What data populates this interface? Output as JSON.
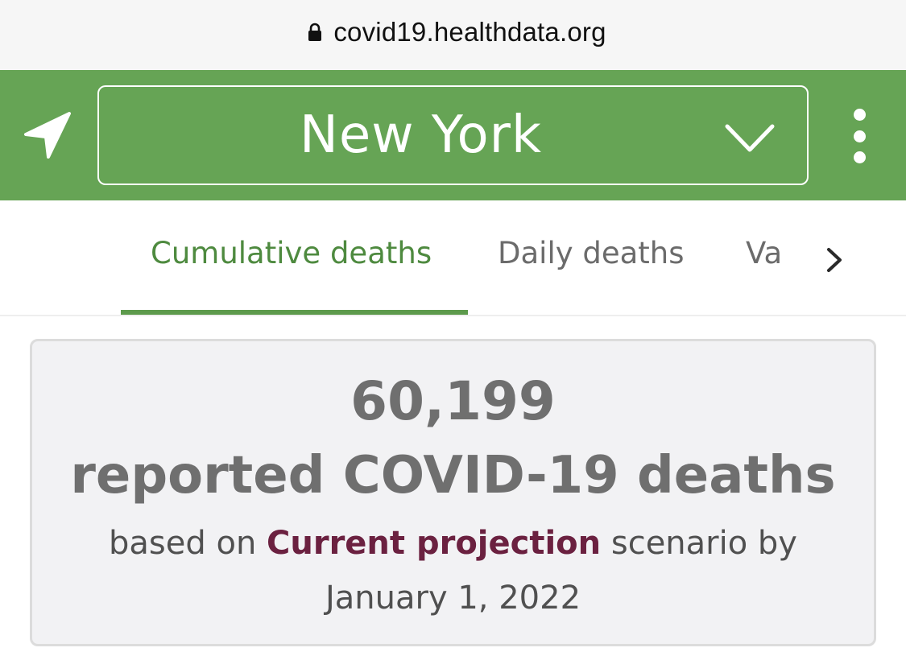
{
  "browser": {
    "url": "covid19.healthdata.org",
    "lock_icon": "lock-icon"
  },
  "header": {
    "location_icon": "navigation-arrow-icon",
    "location": "New York",
    "dropdown_icon": "chevron-down-icon",
    "menu_icon": "kebab-menu-icon",
    "background_color": "#66a455"
  },
  "tabs": {
    "items": [
      {
        "label": "Cumulative deaths",
        "active": true
      },
      {
        "label": "Daily deaths",
        "active": false
      },
      {
        "label": "Va",
        "active": false
      }
    ],
    "next_icon": "chevron-right-icon",
    "active_color": "#4e8a3f"
  },
  "summary": {
    "count": "60,199",
    "label": "reported COVID-19 deaths",
    "prefix": "based on",
    "scenario": "Current projection",
    "suffix": "scenario by",
    "date": "January 1, 2022",
    "scenario_color": "#6b2140"
  }
}
